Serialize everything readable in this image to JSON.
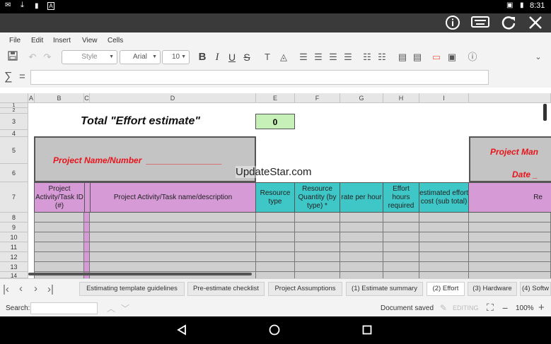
{
  "status_bar": {
    "time": "8:31",
    "left_icons": [
      "mail-icon",
      "download-icon",
      "sd-card-icon",
      "text-icon"
    ],
    "right_icons": [
      "no-sim-icon",
      "battery-icon"
    ]
  },
  "title_bar": {
    "buttons": [
      {
        "name": "info-button",
        "glyph": "ⓘ"
      },
      {
        "name": "keyboard-button",
        "glyph": "⌨"
      },
      {
        "name": "refresh-button",
        "glyph": "↻"
      },
      {
        "name": "close-button",
        "glyph": "✕"
      }
    ]
  },
  "menu": {
    "file": "File",
    "edit": "Edit",
    "insert": "Insert",
    "view": "View",
    "cells": "Cells"
  },
  "toolbar": {
    "style_placeholder": "Style",
    "font_name": "Arial",
    "font_size": "10",
    "bold": "B",
    "italic": "I",
    "underline": "U",
    "strikethrough": "S"
  },
  "formula_bar": {
    "sigma": "∑",
    "equals": "=",
    "value": ""
  },
  "columns": [
    "A",
    "B",
    "C",
    "D",
    "E",
    "F",
    "G",
    "H",
    "I"
  ],
  "rows": [
    "1",
    "2",
    "3",
    "4",
    "5",
    "6",
    "7",
    "8",
    "9",
    "10",
    "11",
    "12",
    "13",
    "14"
  ],
  "sheet": {
    "total_label": "Total \"Effort estimate\"",
    "total_value": "0",
    "project_name_label": "Project Name/Number  ________________",
    "project_man_label": "Project Man",
    "date_label": "Date _",
    "watermark": "UpdateStar.com",
    "headers": {
      "activity_id": "Project Activity/Task ID (#)",
      "activity_name": "Project Activity/Task name/description",
      "resource_type": "Resource type",
      "resource_quantity": "Resource Quantity (by type) *",
      "rate_per_hour": "rate per hour",
      "effort_hours": "Effort hours required",
      "estimated_cost": "estimated effort cost (sub total)",
      "remarks_partial": "Re"
    }
  },
  "sheet_tabs": [
    "Estimating template guidelines",
    "Pre-estimate checklist",
    "Project Assumptions",
    "(1) Estimate summary",
    "(2) Effort",
    "(3) Hardware",
    "(4) Softw"
  ],
  "active_tab_index": 4,
  "find_bar": {
    "search_label": "Search:",
    "search_value": "",
    "doc_status": "Document saved",
    "editing_label": "EDITING",
    "zoom": "100%",
    "minus": "−",
    "plus": "+"
  },
  "colors": {
    "purple_header": "#d69ad6",
    "teal_header": "#3fc6c6",
    "total_box": "#c6f0b8",
    "red_text": "#e8141c"
  }
}
